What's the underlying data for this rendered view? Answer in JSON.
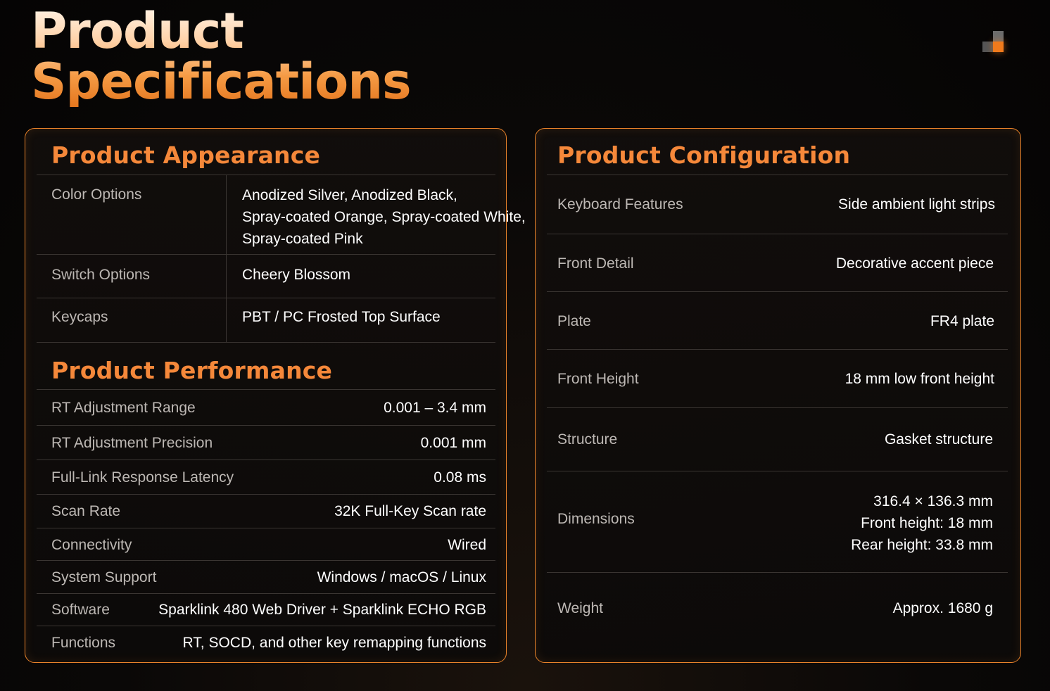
{
  "title": {
    "line1": "Product",
    "line2": "Specifications"
  },
  "brand": {
    "logo_icon": "brand-blocks-logo",
    "accent_color": "#f07a1c"
  },
  "appearance": {
    "title": "Product Appearance",
    "rows": [
      {
        "label": "Color Options",
        "value_lines": [
          "Anodized Silver, Anodized Black,",
          "Spray-coated Orange, Spray-coated White,",
          "Spray-coated Pink"
        ]
      },
      {
        "label": "Switch Options",
        "value": "Cheery Blossom"
      },
      {
        "label": "Keycaps",
        "value": "PBT / PC Frosted Top Surface"
      }
    ]
  },
  "performance": {
    "title": "Product Performance",
    "rows": [
      {
        "label": "RT Adjustment Range",
        "value": "0.001 – 3.4 mm"
      },
      {
        "label": "RT Adjustment Precision",
        "value": "0.001 mm"
      },
      {
        "label": "Full-Link Response Latency",
        "value": "0.08 ms"
      },
      {
        "label": "Scan Rate",
        "value": "32K Full-Key Scan rate"
      },
      {
        "label": "Connectivity",
        "value": "Wired"
      },
      {
        "label": "System Support",
        "value": "Windows / macOS / Linux"
      },
      {
        "label": "Software",
        "value": "Sparklink 480 Web Driver + Sparklink ECHO RGB"
      },
      {
        "label": "Functions",
        "value": "RT, SOCD, and other key remapping functions"
      }
    ]
  },
  "configuration": {
    "title": "Product Configuration",
    "rows": [
      {
        "label": "Keyboard Features",
        "value": "Side ambient light strips"
      },
      {
        "label": "Front Detail",
        "value": "Decorative accent piece"
      },
      {
        "label": "Plate",
        "value": "FR4 plate"
      },
      {
        "label": "Front Height",
        "value": "18 mm low front height"
      },
      {
        "label": "Structure",
        "value": "Gasket structure"
      },
      {
        "label": "Dimensions",
        "value_lines": [
          "316.4 × 136.3 mm",
          "Front height: 18 mm",
          "Rear height: 33.8 mm"
        ]
      },
      {
        "label": "Weight",
        "value": "Approx. 1680 g"
      }
    ]
  }
}
